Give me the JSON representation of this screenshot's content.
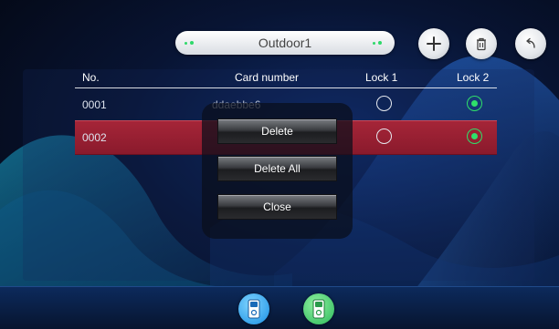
{
  "header": {
    "title": "Outdoor1",
    "buttons": [
      {
        "name": "add",
        "icon": "plus-icon"
      },
      {
        "name": "delete",
        "icon": "trash-icon"
      },
      {
        "name": "back",
        "icon": "back-arrow-icon"
      }
    ]
  },
  "table": {
    "columns": [
      "No.",
      "Card number",
      "Lock 1",
      "Lock 2"
    ],
    "rows": [
      {
        "no": "0001",
        "card": "ddaebbe6",
        "lock1": false,
        "lock2": true,
        "selected": false
      },
      {
        "no": "0002",
        "card": "",
        "lock1": false,
        "lock2": true,
        "selected": true
      }
    ]
  },
  "popup": {
    "delete_label": "Delete",
    "delete_all_label": "Delete All",
    "close_label": "Close"
  },
  "bottom_bar": {
    "icons": [
      "door-station-icon",
      "door-station-icon"
    ]
  },
  "colors": {
    "selected_row": "#a52538",
    "active_radio": "#2fe06a",
    "bar": "#0c2a5c"
  }
}
